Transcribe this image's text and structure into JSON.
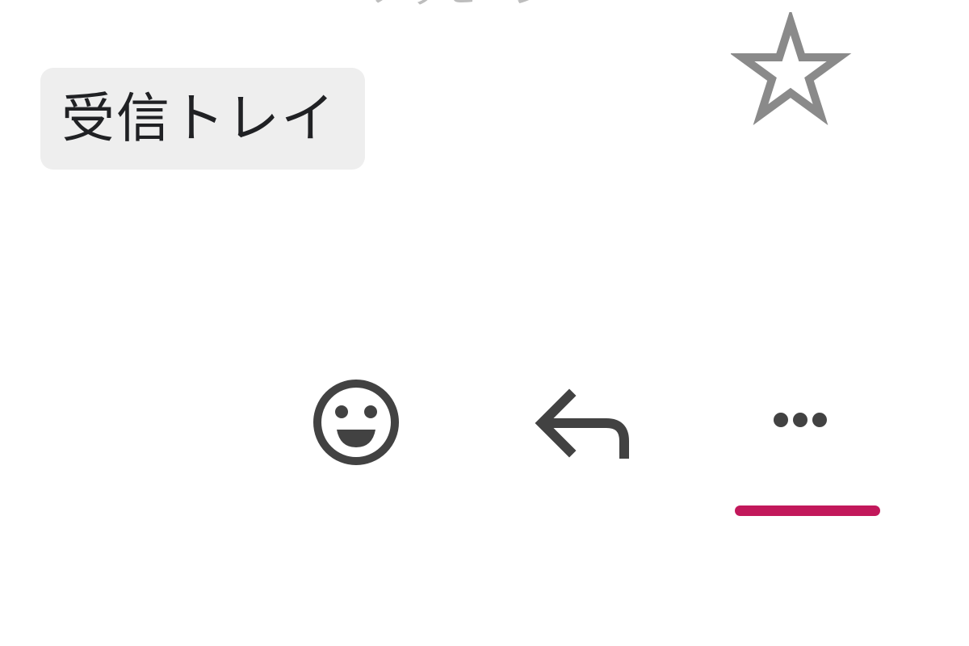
{
  "header": {
    "clipped_title": "メッセージ"
  },
  "label_chip": {
    "text": "受信トレイ"
  },
  "toolbar": {
    "star_icon": "star-outline-icon",
    "actions": [
      {
        "name": "emoji-reaction",
        "icon": "smiley-face-icon"
      },
      {
        "name": "reply",
        "icon": "reply-arrow-icon"
      },
      {
        "name": "more",
        "icon": "more-horizontal-icon"
      }
    ],
    "active_action": "more"
  },
  "colors": {
    "accent": "#c2185b",
    "icon": "#424242",
    "star": "#8a8a8a",
    "chip_bg": "#eeeeee",
    "text": "#202124"
  }
}
